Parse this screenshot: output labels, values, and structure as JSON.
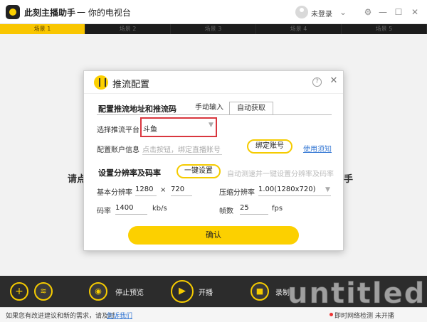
{
  "app": {
    "title": "此刻主播助手",
    "slogan": "一 你的电视台",
    "login_label": "未登录"
  },
  "scenes": [
    "场景 1",
    "场景 2",
    "场景 3",
    "场景 4",
    "场景 5"
  ],
  "background": {
    "left_text": "请点",
    "right_text": "手"
  },
  "dialog": {
    "title": "推流配置",
    "help_glyph": "?",
    "close_glyph": "✕",
    "section_stream": "配置推流地址和推流码",
    "tabs": [
      {
        "label": "手动输入",
        "active": false
      },
      {
        "label": "自动获取",
        "active": true
      }
    ],
    "platform_label": "选择推流平台",
    "platform_value": "斗鱼",
    "account_label": "配置账户信息",
    "account_hint": "点击按钮，绑定直播账号",
    "bind_button": "绑定账号",
    "help_link": "使用须知",
    "section_resolution": "设置分辨率及码率",
    "one_click_button": "一键设置",
    "one_click_hint": "自动测速并一键设置分辨率及码率",
    "base_res_label": "基本分辨率",
    "base_width": "1280",
    "times": "×",
    "base_height": "720",
    "compress_label": "压缩分辨率",
    "compress_value": "1.00(1280x720)",
    "bitrate_label": "码率",
    "bitrate_value": "1400",
    "bitrate_unit": "kb/s",
    "fps_label": "帧数",
    "fps_value": "25",
    "fps_unit": "fps",
    "confirm_button": "确认"
  },
  "toolbar": {
    "stop_preview": "停止预览",
    "start_stream": "开播",
    "record": "录制"
  },
  "footer": {
    "text": "如果您有改进建议和新的需求，请及时",
    "link": "告诉我们",
    "right": "即时网络检测  未开播"
  },
  "watermark": "untitled"
}
